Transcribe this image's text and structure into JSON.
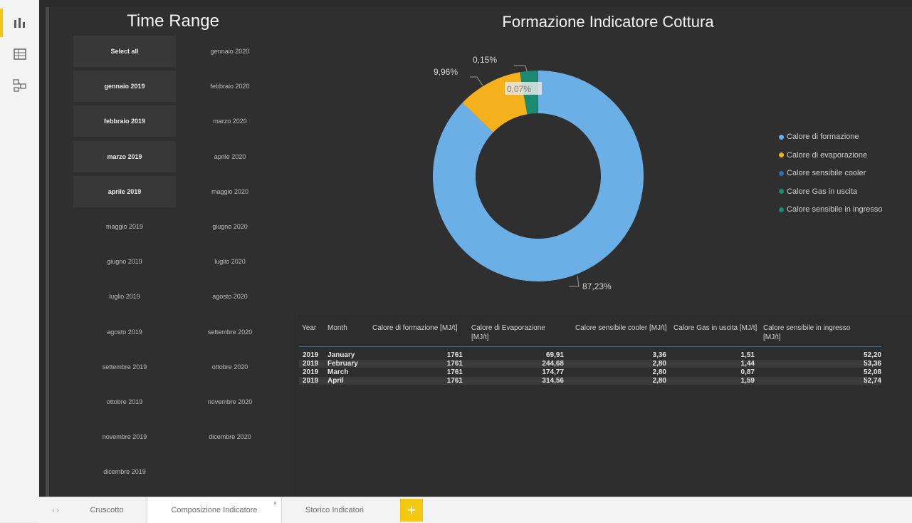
{
  "nav": {
    "icons": [
      "report-view-icon",
      "data-view-icon",
      "model-view-icon"
    ]
  },
  "slicer": {
    "title": "Time Range",
    "items": [
      {
        "label": "Select all",
        "selected": true
      },
      {
        "label": "gennaio 2020",
        "selected": false
      },
      {
        "label": "gennaio 2019",
        "selected": true
      },
      {
        "label": "febbraio 2020",
        "selected": false
      },
      {
        "label": "febbraio 2019",
        "selected": true
      },
      {
        "label": "marzo 2020",
        "selected": false
      },
      {
        "label": "marzo 2019",
        "selected": true
      },
      {
        "label": "aprile 2020",
        "selected": false
      },
      {
        "label": "aprile 2019",
        "selected": true
      },
      {
        "label": "maggio 2020",
        "selected": false
      },
      {
        "label": "maggio 2019",
        "selected": false
      },
      {
        "label": "giugno 2020",
        "selected": false
      },
      {
        "label": "giugno 2019",
        "selected": false
      },
      {
        "label": "luglio 2020",
        "selected": false
      },
      {
        "label": "luglio 2019",
        "selected": false
      },
      {
        "label": "agosto 2020",
        "selected": false
      },
      {
        "label": "agosto 2019",
        "selected": false
      },
      {
        "label": "settembre 2020",
        "selected": false
      },
      {
        "label": "settembre 2019",
        "selected": false
      },
      {
        "label": "ottobre 2020",
        "selected": false
      },
      {
        "label": "ottobre 2019",
        "selected": false
      },
      {
        "label": "novembre 2020",
        "selected": false
      },
      {
        "label": "novembre 2019",
        "selected": false
      },
      {
        "label": "dicembre 2020",
        "selected": false
      },
      {
        "label": "dicembre 2019",
        "selected": false
      }
    ]
  },
  "chart": {
    "title": "Formazione Indicatore Cottura",
    "labels": {
      "pct_formazione": "87,23%",
      "pct_evaporazione": "9,96%",
      "pct_cooler": "0,15%",
      "pct_gas": "0,07%"
    }
  },
  "chart_data": {
    "type": "pie",
    "title": "Formazione Indicatore Cottura",
    "categories": [
      "Calore di formazione",
      "Calore di evaporazione",
      "Calore sensibile cooler",
      "Calore Gas in uscita",
      "Calore sensibile in ingresso"
    ],
    "values": [
      87.23,
      9.96,
      0.15,
      0.07,
      2.59
    ],
    "colors": [
      "#6aafe6",
      "#f5b11c",
      "#2f6eb5",
      "#1a8a73",
      "#1a8a73"
    ],
    "donut": true,
    "legend_position": "right"
  },
  "legend": [
    {
      "label": "Calore di formazione",
      "color": "#6aafe6"
    },
    {
      "label": "Calore di evaporazione",
      "color": "#f5b11c"
    },
    {
      "label": "Calore sensibile cooler",
      "color": "#2f6eb5"
    },
    {
      "label": "Calore Gas in uscita",
      "color": "#1a8a73"
    },
    {
      "label": "Calore sensibile in ingresso",
      "color": "#1a8a73"
    }
  ],
  "table": {
    "columns": [
      "Year",
      "Month",
      "Calore di formazione [MJ/t]",
      "Calore di Evaporazione [MJ/t]",
      "Calore sensibile cooler [MJ/t]",
      "Calore Gas in uscita [MJ/t]",
      "Calore sensibile in ingresso [MJ/t]"
    ],
    "rows": [
      [
        "2019",
        "January",
        "1761",
        "69,91",
        "3,36",
        "1,51",
        "52,20"
      ],
      [
        "2019",
        "February",
        "1761",
        "244,68",
        "2,80",
        "1,44",
        "53,36"
      ],
      [
        "2019",
        "March",
        "1761",
        "174,77",
        "2,80",
        "0,87",
        "52,08"
      ],
      [
        "2019",
        "April",
        "1761",
        "314,56",
        "2,80",
        "1,59",
        "52,74"
      ]
    ]
  },
  "tabs": {
    "items": [
      {
        "label": "Cruscotto",
        "active": false
      },
      {
        "label": "Composizione Indicatore",
        "active": true
      },
      {
        "label": "Storico Indicatori",
        "active": false
      }
    ],
    "add_label": "+",
    "close_label": "×"
  },
  "colors": {
    "accent": "#f2c811",
    "canvas": "#2b2b2b"
  }
}
